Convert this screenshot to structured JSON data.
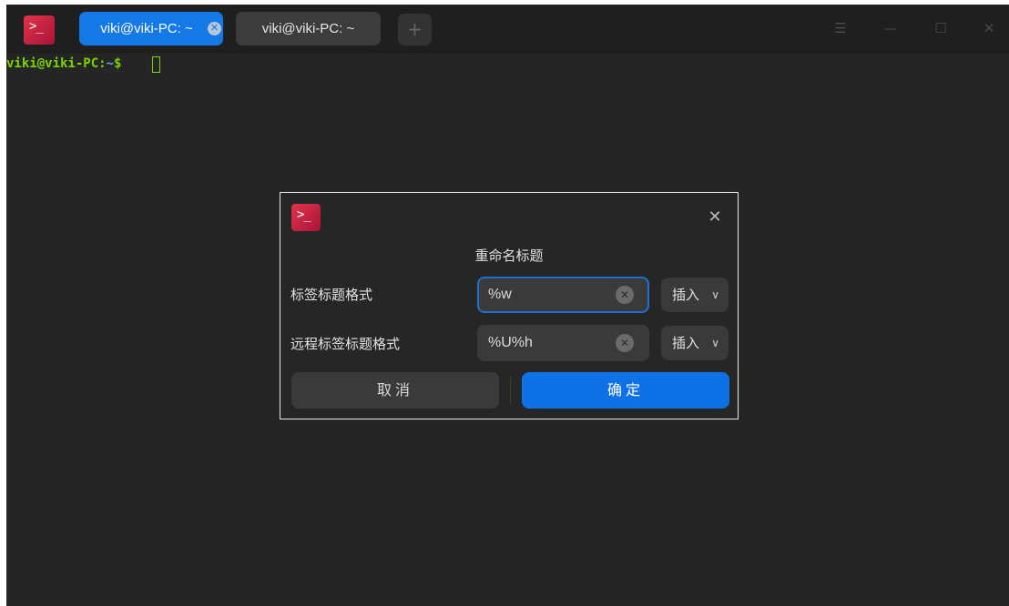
{
  "titlebar": {
    "icon": "terminal-icon",
    "tabs": [
      {
        "label": "viki@viki-PC: ~",
        "active": true
      },
      {
        "label": "viki@viki-PC: ~",
        "active": false
      }
    ],
    "new_tab_symbol": "+",
    "window_buttons": {
      "menu": "☰",
      "minimize": "—",
      "maximize": "☐",
      "close": "✕"
    }
  },
  "terminal": {
    "user_host": "viki@viki-PC",
    "separator": ":",
    "path": "~",
    "prompt_symbol": "$"
  },
  "dialog": {
    "title": "重命名标题",
    "close_symbol": "✕",
    "rows": [
      {
        "label": "标签标题格式",
        "value": "%w",
        "insert_label": "插入"
      },
      {
        "label": "远程标签标题格式",
        "value": "%U%h",
        "insert_label": "插入"
      }
    ],
    "cancel_label": "取消",
    "ok_label": "确定"
  },
  "colors": {
    "accent": "#1478e6",
    "prompt_green": "#7bd300",
    "background": "#252525"
  }
}
